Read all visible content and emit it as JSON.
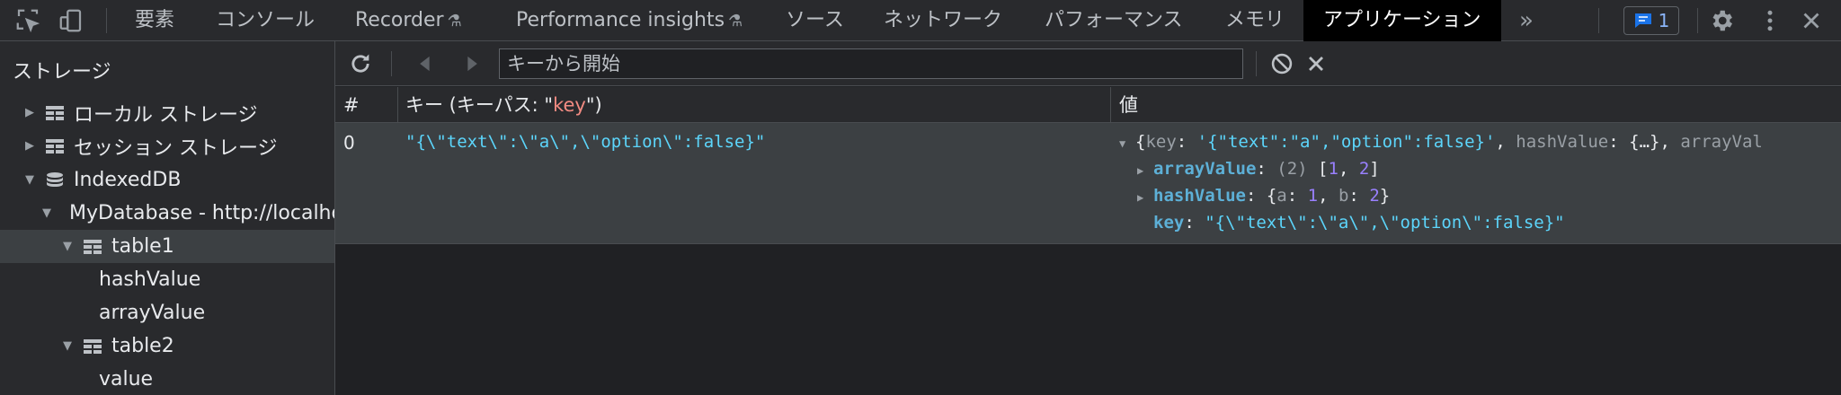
{
  "topbar": {
    "tabs": [
      {
        "label": "要素",
        "flask": false
      },
      {
        "label": "コンソール",
        "flask": false
      },
      {
        "label": "Recorder",
        "flask": true
      },
      {
        "label": "Performance insights",
        "flask": true
      },
      {
        "label": "ソース",
        "flask": false
      },
      {
        "label": "ネットワーク",
        "flask": false
      },
      {
        "label": "パフォーマンス",
        "flask": false
      },
      {
        "label": "メモリ",
        "flask": false
      },
      {
        "label": "アプリケーション",
        "flask": false,
        "active": true
      }
    ],
    "more_label": "»",
    "flask_glyph": "⚗",
    "issues_count": "1"
  },
  "sidebar": {
    "title": "ストレージ",
    "items": [
      {
        "label": "ローカル ストレージ",
        "icon": "grid-icon",
        "expand": "collapsed"
      },
      {
        "label": "セッション ストレージ",
        "icon": "grid-icon",
        "expand": "collapsed"
      },
      {
        "label": "IndexedDB",
        "icon": "database-icon",
        "expand": "expanded"
      },
      {
        "label": "MyDatabase - http://localhost",
        "icon": "database-icon",
        "expand": "expanded"
      },
      {
        "label": "table1",
        "icon": "grid-icon",
        "expand": "expanded",
        "selected": true
      },
      {
        "label": "hashValue",
        "icon": "none",
        "expand": "none"
      },
      {
        "label": "arrayValue",
        "icon": "none",
        "expand": "none"
      },
      {
        "label": "table2",
        "icon": "grid-icon",
        "expand": "expanded"
      },
      {
        "label": "value",
        "icon": "none",
        "expand": "none"
      }
    ]
  },
  "toolbar": {
    "search_placeholder": "キーから開始"
  },
  "table": {
    "headers": {
      "index": "#",
      "key_prefix": "キー (キーパス: \"",
      "key_path": "key",
      "key_suffix": "\")",
      "value": "値"
    },
    "rows": [
      {
        "index": "0",
        "key": "\"{\\\"text\\\":\\\"a\\\",\\\"option\\\":false}\"",
        "value": {
          "summary_open": "{",
          "summary_key_label": "key",
          "summary_key_value": "'{\"text\":\"a\",\"option\":false}'",
          "summary_hash_label": "hashValue",
          "summary_hash_value": "{…}",
          "summary_array_label": "arrayVal",
          "array_label": "arrayValue",
          "array_len": "(2)",
          "array_items": [
            "1",
            "2"
          ],
          "hash_label": "hashValue",
          "hash_entries": [
            {
              "k": "a",
              "v": "1"
            },
            {
              "k": "b",
              "v": "2"
            }
          ],
          "key_label": "key",
          "key_value": "\"{\\\"text\\\":\\\"a\\\",\\\"option\\\":false}\""
        }
      }
    ]
  },
  "colors": {
    "accent": "#8ab4f8",
    "string": "#5cd5fb",
    "number": "#9980ff",
    "key_highlight": "#f28b82",
    "selected_row": "#3c4043"
  }
}
